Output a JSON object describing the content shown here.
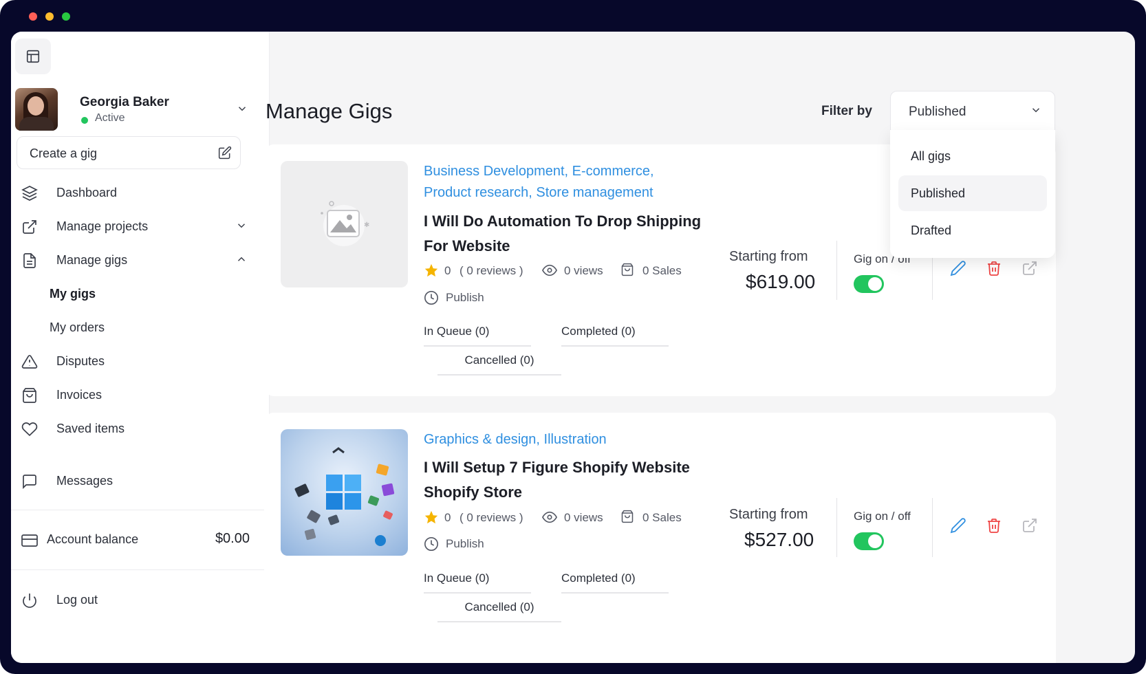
{
  "user": {
    "name": "Georgia Baker",
    "status": "Active"
  },
  "sidebar": {
    "create_gig_label": "Create a gig",
    "items": [
      {
        "label": "Dashboard"
      },
      {
        "label": "Manage projects"
      },
      {
        "label": "Manage gigs"
      },
      {
        "label": "Disputes"
      },
      {
        "label": "Invoices"
      },
      {
        "label": "Saved items"
      },
      {
        "label": "Messages"
      }
    ],
    "subitems": [
      {
        "label": "My gigs"
      },
      {
        "label": "My orders"
      }
    ],
    "account_balance_label": "Account balance",
    "account_balance_value": "$0.00",
    "logout_label": "Log out"
  },
  "main": {
    "title": "Manage Gigs",
    "filter": {
      "label": "Filter by",
      "selected": "Published",
      "options": [
        "All gigs",
        "Published",
        "Drafted"
      ]
    },
    "gigs": [
      {
        "categories_line1": "Business Development, E-commerce,",
        "categories_line2": "Product research, Store management",
        "title_line1": "I Will Do Automation To Drop Shipping",
        "title_line2": "For Website",
        "rating": "0",
        "reviews": "( 0 reviews )",
        "views": "0 views",
        "sales": "0 Sales",
        "status": "Publish",
        "in_queue": "In Queue (0)",
        "completed": "Completed (0)",
        "cancelled": "Cancelled (0)",
        "price_label": "Starting from",
        "price": "$619.00",
        "toggle_label": "Gig on / off",
        "enabled": true
      },
      {
        "categories_line1": "Graphics & design, Illustration",
        "title_line1": "I Will Setup 7 Figure Shopify Website",
        "title_line2": "Shopify Store",
        "rating": "0",
        "reviews": "( 0 reviews )",
        "views": "0 views",
        "sales": "0 Sales",
        "status": "Publish",
        "in_queue": "In Queue (0)",
        "completed": "Completed (0)",
        "cancelled": "Cancelled (0)",
        "price_label": "Starting from",
        "price": "$527.00",
        "toggle_label": "Gig on / off",
        "enabled": true
      }
    ]
  },
  "colors": {
    "accent": "#2f8fe0",
    "toggle_on": "#22c55e",
    "delete": "#ef4444",
    "status_active": "#22c55e"
  },
  "icons": [
    "sidebar-toggle-icon",
    "chevron-down-icon",
    "edit-icon",
    "layers-icon",
    "external-link-icon",
    "file-text-icon",
    "chevron-up-icon",
    "alert-triangle-icon",
    "shopping-bag-icon",
    "heart-icon",
    "message-square-icon",
    "credit-card-icon",
    "power-icon",
    "star-icon",
    "eye-icon",
    "clock-icon",
    "pencil-icon",
    "trash-icon",
    "share-icon",
    "image-placeholder-icon"
  ]
}
